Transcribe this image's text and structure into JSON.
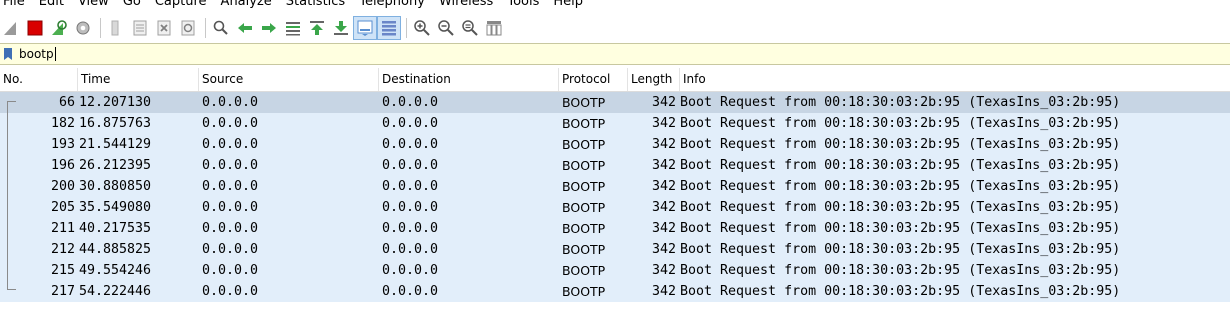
{
  "menu": [
    "File",
    "Edit",
    "View",
    "Go",
    "Capture",
    "Analyze",
    "Statistics",
    "Telephony",
    "Wireless",
    "Tools",
    "Help"
  ],
  "toolbar": {
    "icons": [
      "shark-fin-start-icon",
      "stop-square-icon",
      "restart-shark-fin-icon",
      "capture-options-gear-icon",
      "open-file-icon",
      "save-file-icon",
      "close-file-icon",
      "reload-file-icon",
      "find-packet-icon",
      "go-back-arrow-icon",
      "go-forward-arrow-icon",
      "go-to-packet-icon",
      "first-packet-icon",
      "last-packet-icon",
      "autoscroll-icon",
      "colorize-icon",
      "zoom-in-icon",
      "zoom-out-icon",
      "normal-size-icon",
      "resize-columns-icon"
    ]
  },
  "filter": {
    "value": "bootp"
  },
  "columns": [
    "No.",
    "Time",
    "Source",
    "Destination",
    "Protocol",
    "Length",
    "Info"
  ],
  "packets": [
    {
      "no": "66",
      "time": "12.207130",
      "src": "0.0.0.0",
      "dst": "0.0.0.0",
      "proto": "BOOTP",
      "len": "342",
      "info": "Boot Request from 00:18:30:03:2b:95 (TexasIns_03:2b:95)"
    },
    {
      "no": "182",
      "time": "16.875763",
      "src": "0.0.0.0",
      "dst": "0.0.0.0",
      "proto": "BOOTP",
      "len": "342",
      "info": "Boot Request from 00:18:30:03:2b:95 (TexasIns_03:2b:95)"
    },
    {
      "no": "193",
      "time": "21.544129",
      "src": "0.0.0.0",
      "dst": "0.0.0.0",
      "proto": "BOOTP",
      "len": "342",
      "info": "Boot Request from 00:18:30:03:2b:95 (TexasIns_03:2b:95)"
    },
    {
      "no": "196",
      "time": "26.212395",
      "src": "0.0.0.0",
      "dst": "0.0.0.0",
      "proto": "BOOTP",
      "len": "342",
      "info": "Boot Request from 00:18:30:03:2b:95 (TexasIns_03:2b:95)"
    },
    {
      "no": "200",
      "time": "30.880850",
      "src": "0.0.0.0",
      "dst": "0.0.0.0",
      "proto": "BOOTP",
      "len": "342",
      "info": "Boot Request from 00:18:30:03:2b:95 (TexasIns_03:2b:95)"
    },
    {
      "no": "205",
      "time": "35.549080",
      "src": "0.0.0.0",
      "dst": "0.0.0.0",
      "proto": "BOOTP",
      "len": "342",
      "info": "Boot Request from 00:18:30:03:2b:95 (TexasIns_03:2b:95)"
    },
    {
      "no": "211",
      "time": "40.217535",
      "src": "0.0.0.0",
      "dst": "0.0.0.0",
      "proto": "BOOTP",
      "len": "342",
      "info": "Boot Request from 00:18:30:03:2b:95 (TexasIns_03:2b:95)"
    },
    {
      "no": "212",
      "time": "44.885825",
      "src": "0.0.0.0",
      "dst": "0.0.0.0",
      "proto": "BOOTP",
      "len": "342",
      "info": "Boot Request from 00:18:30:03:2b:95 (TexasIns_03:2b:95)"
    },
    {
      "no": "215",
      "time": "49.554246",
      "src": "0.0.0.0",
      "dst": "0.0.0.0",
      "proto": "BOOTP",
      "len": "342",
      "info": "Boot Request from 00:18:30:03:2b:95 (TexasIns_03:2b:95)"
    },
    {
      "no": "217",
      "time": "54.222446",
      "src": "0.0.0.0",
      "dst": "0.0.0.0",
      "proto": "BOOTP",
      "len": "342",
      "info": "Boot Request from 00:18:30:03:2b:95 (TexasIns_03:2b:95)"
    }
  ],
  "colors": {
    "row_bg": "#e2eefa",
    "row_selected": "#c7d5e4",
    "filter_bg": "#ffffe0"
  }
}
